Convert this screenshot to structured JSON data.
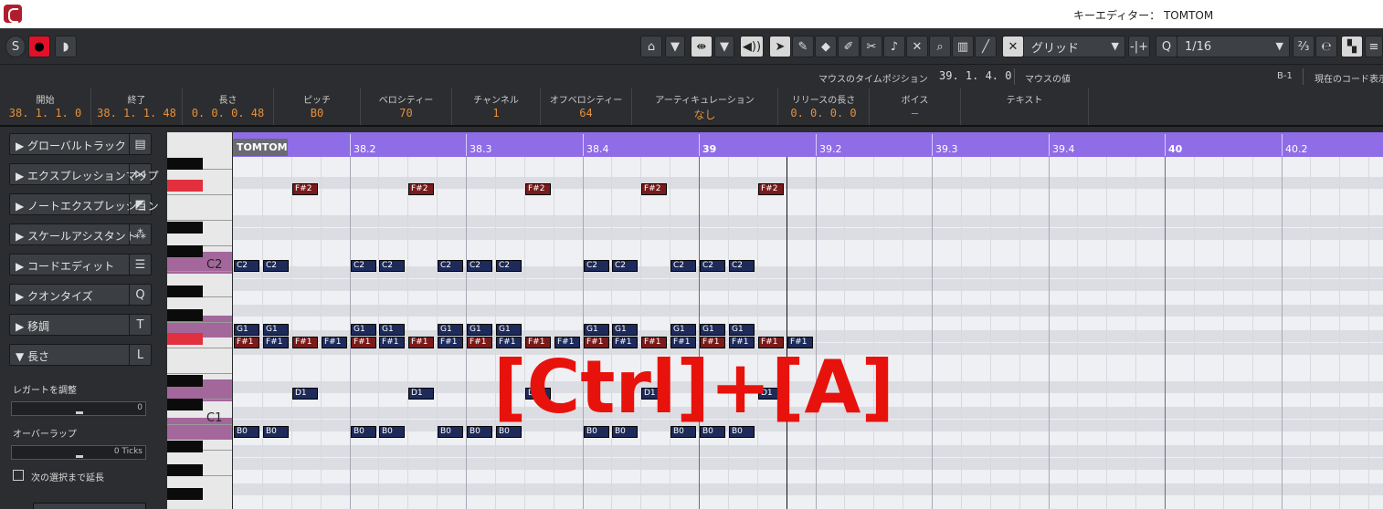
{
  "window": {
    "title": "キーエディター： TOMTOM"
  },
  "toolbar": {
    "solo": "S",
    "record": "●",
    "listen": "◗",
    "grid_type": "グリッド",
    "quantize_label": "Q",
    "quantize_value": "1/16",
    "tool_icons": [
      "arrow-select-icon",
      "pencil-icon",
      "eraser-icon",
      "trim-icon",
      "split-icon",
      "glue-icon",
      "mute-x-icon",
      "zoom-icon",
      "draw-line-icon",
      "line-icon"
    ]
  },
  "infoline": {
    "mouse_time_label": "マウスのタイムポジション",
    "mouse_time_value": "39. 1. 4.   0",
    "mouse_value_label": "マウスの値",
    "chord_value": "B-1",
    "chord_label": "現在のコード表示"
  },
  "infobar": [
    {
      "label": "開始",
      "value": "38. 1. 1.   0"
    },
    {
      "label": "終了",
      "value": "38. 1. 1. 48"
    },
    {
      "label": "長さ",
      "value": "0. 0. 0. 48"
    },
    {
      "label": "ピッチ",
      "value": "B0"
    },
    {
      "label": "ベロシティー",
      "value": "70"
    },
    {
      "label": "チャンネル",
      "value": "1"
    },
    {
      "label": "オフベロシティー",
      "value": "64"
    },
    {
      "label": "アーティキュレーション",
      "value": "なし"
    },
    {
      "label": "リリースの長さ",
      "value": "0. 0. 0.   0"
    },
    {
      "label": "ボイス",
      "value": "–"
    },
    {
      "label": "テキスト",
      "value": ""
    }
  ],
  "inspector": {
    "sections": [
      {
        "label": "▶ グローバルトラック",
        "icon": "▤"
      },
      {
        "label": "▶ エクスプレッションマップ",
        "icon": "⋈"
      },
      {
        "label": "▶ ノートエクスプレッション",
        "icon": "◩"
      },
      {
        "label": "▶ スケールアシスタント",
        "icon": "⁂"
      },
      {
        "label": "▶ コードエディット",
        "icon": "☰"
      },
      {
        "label": "▶ クオンタイズ",
        "icon": "Q"
      },
      {
        "label": "▶ 移調",
        "icon": "T"
      },
      {
        "label": "▼ 長さ",
        "icon": "L"
      }
    ],
    "legato_label": "レガートを調整",
    "legato_value": "0",
    "overlap_label": "オーバーラップ",
    "overlap_value": "0 Ticks",
    "extend_label": "次の選択まで延長"
  },
  "piano": {
    "c2": "C2",
    "c1": "C1"
  },
  "ruler": {
    "part": "TOMTOM",
    "marks": [
      "38.2",
      "38.3",
      "38.4",
      "39",
      "39.2",
      "39.3",
      "39.4",
      "40",
      "40.2"
    ]
  },
  "notes": {
    "Fs2": {
      "label": "F#2",
      "starts": [
        0.5,
        1.5,
        2.5,
        3.5,
        4.5
      ]
    },
    "C2": {
      "label": "C2",
      "starts": [
        0,
        0.25,
        1,
        1.25,
        1.75,
        2,
        2.25,
        3,
        3.25,
        3.75,
        4,
        4.25
      ]
    },
    "G1": {
      "label": "G1",
      "starts": [
        0,
        0.25,
        1,
        1.25,
        1.75,
        2,
        2.25,
        3,
        3.25,
        3.75,
        4,
        4.25
      ]
    },
    "Fs1": {
      "label": "F#1",
      "starts": [
        0,
        0.25,
        0.5,
        0.75,
        1,
        1.25,
        1.5,
        1.75,
        2,
        2.25,
        2.5,
        2.75,
        3,
        3.25,
        3.5,
        3.75,
        4,
        4.25,
        4.5,
        4.75
      ]
    },
    "D1": {
      "label": "D1",
      "starts": [
        0.5,
        1.5,
        2.5,
        3.5,
        4.5
      ]
    },
    "B0": {
      "label": "B0",
      "starts": [
        0,
        0.25,
        1,
        1.25,
        1.75,
        2,
        2.25,
        3,
        3.25,
        3.75,
        4,
        4.25
      ]
    }
  },
  "overlay_text": "[Ctrl]+[A]",
  "colors": {
    "ruler": "#8f6de6",
    "note_selected": "#7a1a1a",
    "note_normal": "#1d2a5a",
    "record": "#e3102a",
    "overlay": "#e8120c"
  }
}
